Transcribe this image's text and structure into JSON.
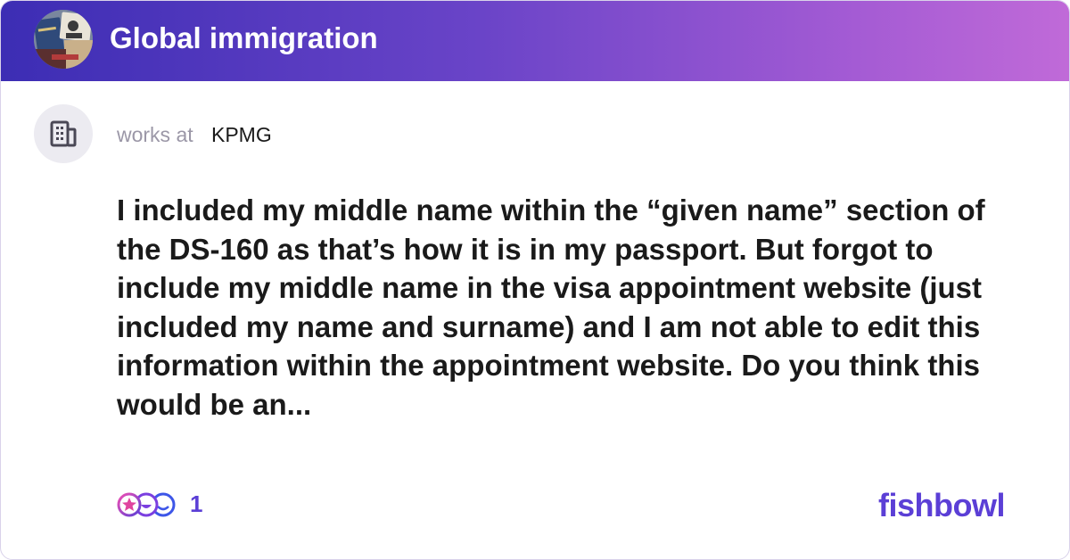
{
  "header": {
    "bowl_name": "Global immigration",
    "avatar_icon": "passport-collage-icon",
    "gradient_colors": [
      "#3c2db4",
      "#c06ad8"
    ]
  },
  "author": {
    "works_at_label": "works at",
    "company": "KPMG",
    "company_icon": "office-building-icon"
  },
  "post": {
    "text": "I included my middle name within the “given name” section of the DS-160 as that’s how it is in my passport. But forgot to include my middle name in the visa appointment website (just included my name and surname) and I am not able to edit this information within the appointment website. Do you think this would be an..."
  },
  "footer": {
    "reaction_icons": [
      "star-reaction-icon",
      "laugh-reaction-icon",
      "smile-reaction-icon"
    ],
    "reaction_count": "1",
    "brand": "fishbowl",
    "accent_color": "#5b3fd6"
  }
}
